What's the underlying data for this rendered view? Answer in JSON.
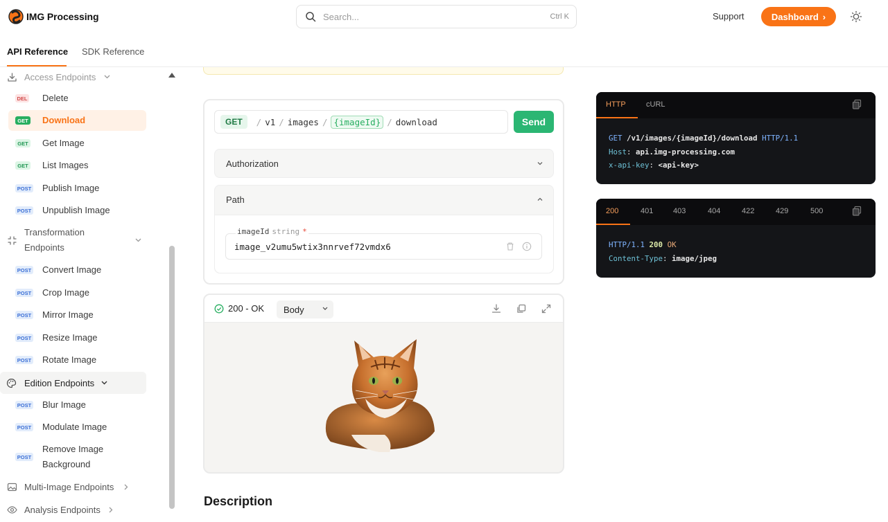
{
  "brand": {
    "name": "IMG Processing"
  },
  "search": {
    "placeholder": "Search...",
    "shortcut": "Ctrl K"
  },
  "header": {
    "support": "Support",
    "dashboard": "Dashboard",
    "dashboard_chevron": "›"
  },
  "tabs": [
    {
      "label": "API Reference",
      "active": true
    },
    {
      "label": "SDK Reference",
      "active": false
    }
  ],
  "sidebar": {
    "groups": {
      "access": "Access Endpoints",
      "transformation": "Transformation Endpoints",
      "edition": "Edition Endpoints",
      "multi": "Multi-Image Endpoints",
      "analysis": "Analysis Endpoints"
    },
    "items": [
      {
        "method": "DEL",
        "label": "Delete"
      },
      {
        "method": "GET",
        "label": "Download",
        "active": true
      },
      {
        "method": "GET",
        "label": "Get Image"
      },
      {
        "method": "GET",
        "label": "List Images"
      },
      {
        "method": "POST",
        "label": "Publish Image"
      },
      {
        "method": "POST",
        "label": "Unpublish Image"
      },
      {
        "method": "POST",
        "label": "Convert Image"
      },
      {
        "method": "POST",
        "label": "Crop Image"
      },
      {
        "method": "POST",
        "label": "Mirror Image"
      },
      {
        "method": "POST",
        "label": "Resize Image"
      },
      {
        "method": "POST",
        "label": "Rotate Image"
      },
      {
        "method": "POST",
        "label": "Blur Image"
      },
      {
        "method": "POST",
        "label": "Modulate Image"
      },
      {
        "method": "POST",
        "label": "Remove Image Background"
      }
    ]
  },
  "request": {
    "method": "GET",
    "path_parts": [
      "v1",
      "images",
      "{imageId}",
      "download"
    ],
    "send": "Send",
    "authorization": "Authorization",
    "path_section": "Path",
    "param": {
      "name": "imageId",
      "type": "string",
      "required_mark": "*",
      "value": "image_v2umu5wtix3nnrvef72vmdx6"
    }
  },
  "response": {
    "status": "200 - OK",
    "body_select": "Body"
  },
  "description_heading": "Description",
  "code_request": {
    "tabs": [
      "HTTP",
      "cURL"
    ],
    "line1_method": "GET",
    "line1_path": "/v1/images/{imageId}/download",
    "line1_proto": "HTTP/1.1",
    "line2_key": "Host",
    "line2_val": "api.img-processing.com",
    "line3_key": "x-api-key",
    "line3_val": "<api-key>"
  },
  "code_response": {
    "tabs": [
      "200",
      "401",
      "403",
      "404",
      "422",
      "429",
      "500"
    ],
    "line1_proto": "HTTP/1.1",
    "line1_code": "200",
    "line1_text": "OK",
    "line2_key": "Content-Type",
    "line2_val": "image/jpeg"
  },
  "colors": {
    "accent": "#f97316",
    "send": "#2bb673",
    "code_bg": "#141518"
  }
}
